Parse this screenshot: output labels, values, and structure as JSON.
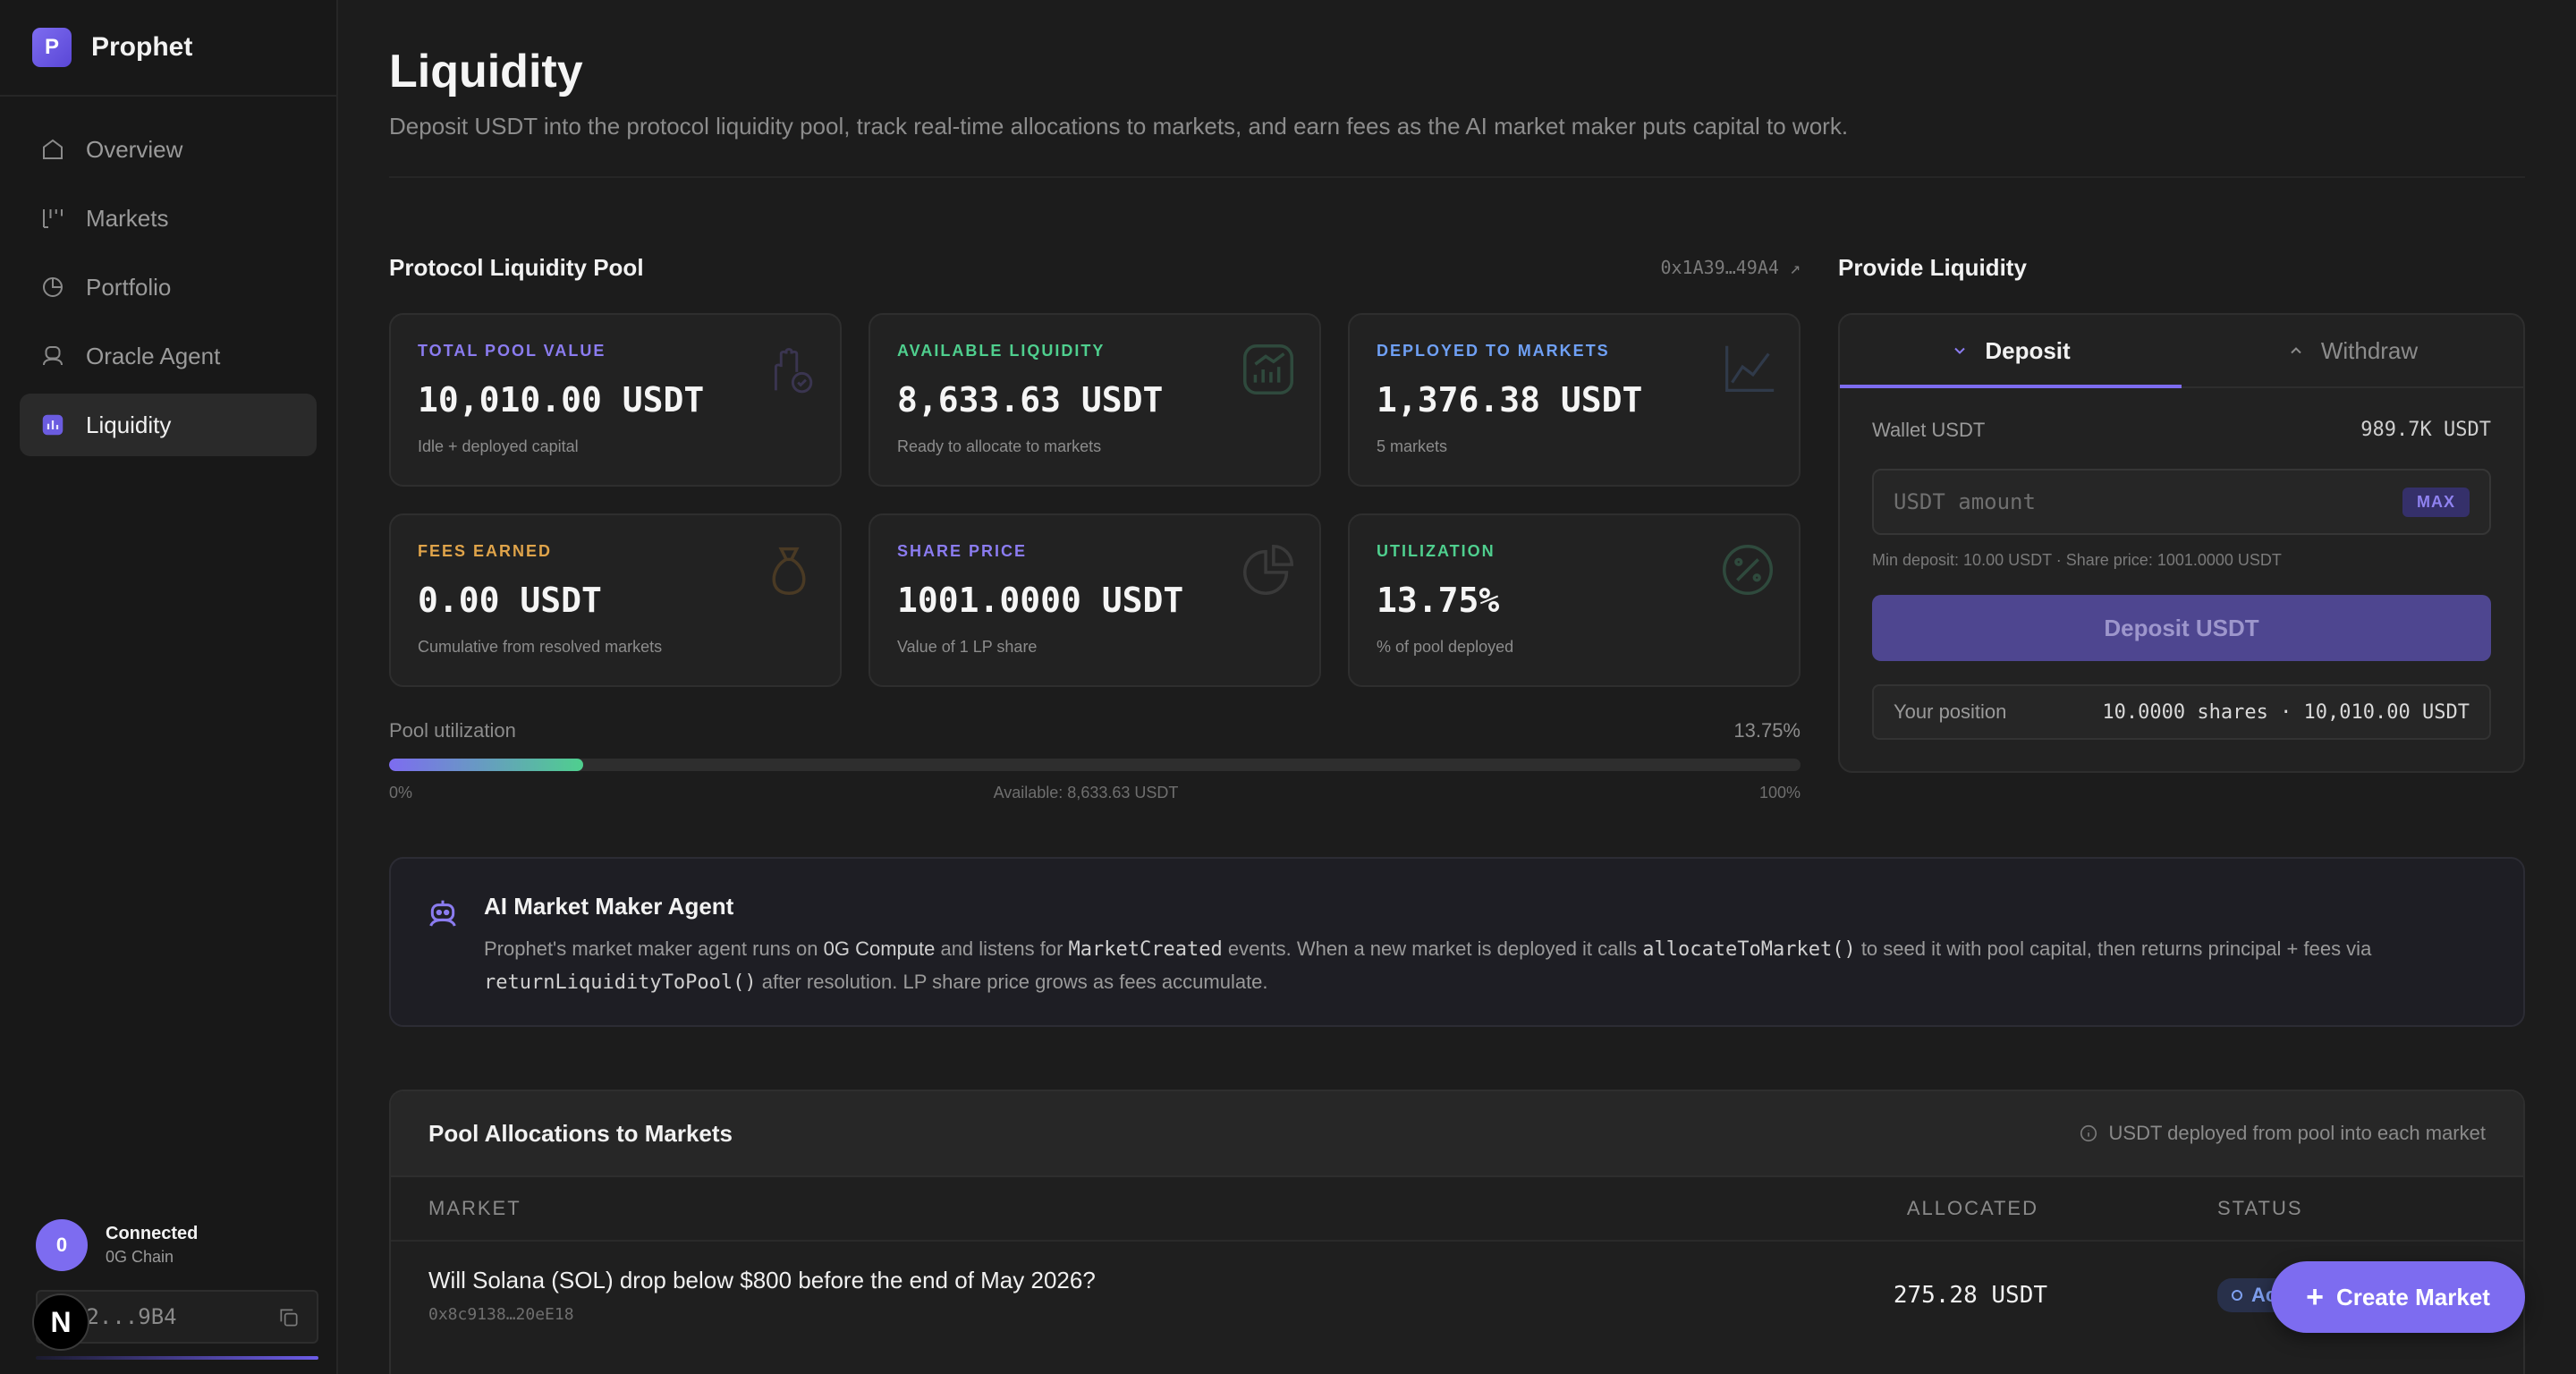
{
  "brand": {
    "logo_letter": "P",
    "name": "Prophet"
  },
  "nav": [
    {
      "label": "Overview",
      "icon": "home-icon"
    },
    {
      "label": "Markets",
      "icon": "markets-icon"
    },
    {
      "label": "Portfolio",
      "icon": "pie-icon"
    },
    {
      "label": "Oracle Agent",
      "icon": "robot-icon"
    },
    {
      "label": "Liquidity",
      "icon": "chart-square-icon",
      "active": true
    }
  ],
  "wallet": {
    "avatar": "0",
    "status": "Connected",
    "chain": "0G Chain",
    "address": "F2...9B4",
    "n_badge": "N"
  },
  "page": {
    "title": "Liquidity",
    "subtitle": "Deposit USDT into the protocol liquidity pool, track real-time allocations to markets, and earn fees as the AI market maker puts capital to work."
  },
  "pool": {
    "title": "Protocol Liquidity Pool",
    "address": "0x1A39…49A4 ↗",
    "stats": [
      {
        "label": "TOTAL POOL VALUE",
        "value": "10,010.00 USDT",
        "note": "Idle + deployed capital",
        "color": "#8b7cf0",
        "icon": "hand-coin-icon"
      },
      {
        "label": "AVAILABLE LIQUIDITY",
        "value": "8,633.63 USDT",
        "note": "Ready to allocate to markets",
        "color": "#4fcf8e",
        "icon": "chart-up-icon"
      },
      {
        "label": "DEPLOYED TO MARKETS",
        "value": "1,376.38 USDT",
        "note": "5 markets",
        "color": "#6fa0f5",
        "icon": "line-chart-icon"
      },
      {
        "label": "FEES EARNED",
        "value": "0.00 USDT",
        "note": "Cumulative from resolved markets",
        "color": "#e0a44a",
        "icon": "money-bag-icon"
      },
      {
        "label": "SHARE PRICE",
        "value": "1001.0000 USDT",
        "note": "Value of 1 LP share",
        "color": "#8b7cf0",
        "icon": "pie-chart-icon"
      },
      {
        "label": "UTILIZATION",
        "value": "13.75%",
        "note": "% of pool deployed",
        "color": "#4fcf8e",
        "icon": "percent-icon"
      }
    ],
    "utilization": {
      "label": "Pool utilization",
      "value_text": "13.75%",
      "fraction": 0.1375,
      "min": "0%",
      "available": "Available: 8,633.63 USDT",
      "max": "100%"
    }
  },
  "provide": {
    "title": "Provide Liquidity",
    "tabs": [
      {
        "label": "Deposit",
        "active": true
      },
      {
        "label": "Withdraw",
        "active": false
      }
    ],
    "wallet_label": "Wallet USDT",
    "wallet_value": "989.7K USDT",
    "amount_placeholder": "USDT amount",
    "max_label": "MAX",
    "hint": "Min deposit: 10.00 USDT · Share price: 1001.0000 USDT",
    "button": "Deposit USDT",
    "position_label": "Your position",
    "position_value": "10.0000 shares · 10,010.00 USDT"
  },
  "agent": {
    "title": "AI Market Maker Agent",
    "t1": "Prophet's market maker agent runs on ",
    "hl1": "0G Compute",
    "t2": " and listens for ",
    "code1": "MarketCreated",
    "t3": " events. When a new market is deployed it calls ",
    "code2": "allocateToMarket()",
    "t4": " to seed it with pool capital, then returns principal + fees via ",
    "code3": "returnLiquidityToPool()",
    "t5": " after resolution. LP share price grows as fees accumulate."
  },
  "alloc": {
    "title": "Pool Allocations to Markets",
    "note": "USDT deployed from pool into each market",
    "columns": {
      "market": "MARKET",
      "allocated": "ALLOCATED",
      "status": "STATUS"
    },
    "rows": [
      {
        "title": "Will Solana (SOL) drop below $800 before the end of May 2026?",
        "address": "0x8c9138…20eE18",
        "allocated": "275.28 USDT",
        "status": "Active"
      }
    ]
  },
  "create_button": "Create Market",
  "colors": {
    "accent": "#7d6cf0",
    "green": "#4fcf8e",
    "blue": "#6fa0f5",
    "orange": "#e0a44a"
  }
}
